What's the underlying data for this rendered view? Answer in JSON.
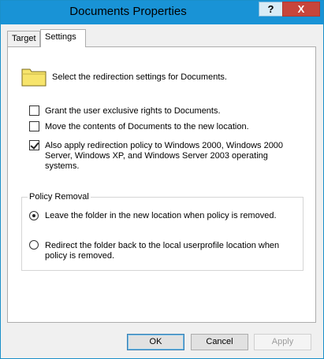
{
  "window": {
    "title": "Documents Properties",
    "help_label": "?",
    "close_label": "X"
  },
  "tabs": [
    {
      "label": "Target",
      "active": false
    },
    {
      "label": "Settings",
      "active": true
    }
  ],
  "settings": {
    "intro": "Select the redirection settings for Documents.",
    "options": [
      {
        "label": "Grant the user exclusive rights to Documents.",
        "checked": false
      },
      {
        "label": "Move the contents of Documents to the new location.",
        "checked": false
      },
      {
        "label": "Also apply redirection policy to Windows 2000, Windows 2000 Server, Windows XP, and Windows Server 2003 operating systems.",
        "checked": true
      }
    ],
    "policy_removal": {
      "legend": "Policy Removal",
      "options": [
        {
          "label": "Leave the folder in the new location when policy is removed.",
          "selected": true
        },
        {
          "label": "Redirect the folder back to the local userprofile location when policy is removed.",
          "selected": false
        }
      ]
    }
  },
  "buttons": {
    "ok": "OK",
    "cancel": "Cancel",
    "apply": "Apply"
  },
  "colors": {
    "titlebar": "#1993d6",
    "close": "#c7453b"
  },
  "icons": {
    "folder": "folder-icon"
  }
}
